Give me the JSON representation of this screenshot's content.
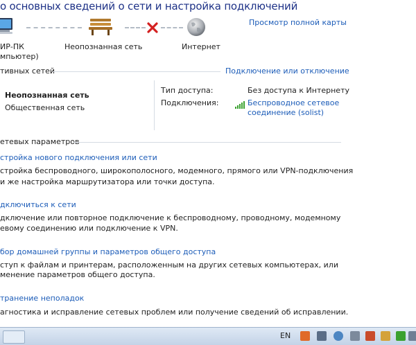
{
  "header": {
    "title": "о основных сведений о сети и настройка подключений",
    "full_map_link": "Просмотр полной карты"
  },
  "map": {
    "computer_name": "ИР-ПК",
    "computer_name_sub": "мпьютер)",
    "network_name": "Неопознанная сеть",
    "internet_label": "Интернет"
  },
  "active_networks": {
    "heading": "тивных сетей",
    "connect_link": "Подключение или отключение",
    "network_name": "Неопознанная сеть",
    "network_type": "Общественная сеть",
    "access_type_label": "Тип доступа:",
    "access_type_value": "Без доступа к Интернету",
    "connections_label": "Подключения:",
    "connection_line1": "Беспроводное сетевое",
    "connection_line2": "соединение (solist)"
  },
  "settings": {
    "heading": "етевых параметров",
    "items": [
      {
        "link": "стройка нового подключения или сети",
        "desc1": "стройка беспроводного, широкополосного, модемного, прямого или VPN-подключения",
        "desc2": "и же настройка маршрутизатора или точки доступа."
      },
      {
        "link": "дключиться к сети",
        "desc1": "дключение или повторное подключение к беспроводному, проводному, модемному",
        "desc2": "евому соединению или подключение к VPN."
      },
      {
        "link": "бор домашней группы и параметров общего доступа",
        "desc1": "ступ к файлам и принтерам, расположенным на других сетевых компьютерах, или",
        "desc2": "менение параметров общего доступа."
      },
      {
        "link": "транение неполадок",
        "desc1": "агностика и исправление сетевых проблем или получение сведений об исправлении.",
        "desc2": ""
      }
    ]
  },
  "taskbar": {
    "language": "EN"
  },
  "icons": {
    "computer": "computer-icon",
    "bench": "bench-network-icon",
    "x_mark": "disconnected-x-icon",
    "globe": "globe-icon",
    "signal": "wireless-signal-icon"
  },
  "colors": {
    "link": "#1c5cb8",
    "title": "#1e3287",
    "x_mark": "#d42020",
    "signal": "#3aa12f"
  }
}
